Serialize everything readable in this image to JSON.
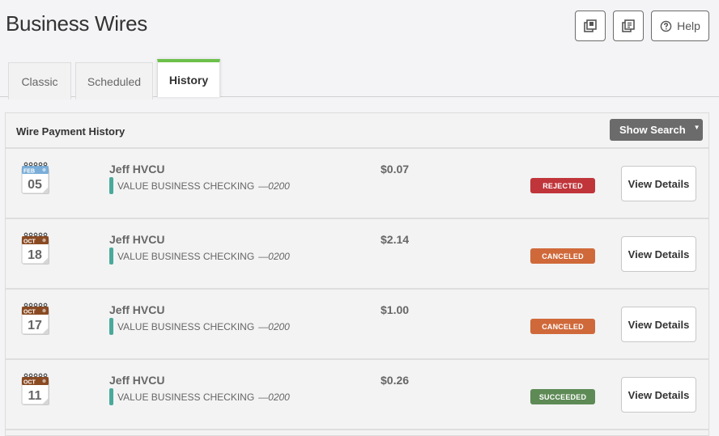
{
  "header": {
    "title": "Business Wires",
    "actions": [
      {
        "name": "print-list-icon",
        "label": ""
      },
      {
        "name": "report-list-icon",
        "label": ""
      },
      {
        "name": "help-icon",
        "label": "Help"
      }
    ]
  },
  "tabs": [
    {
      "label": "Classic",
      "active": false
    },
    {
      "label": "Scheduled",
      "active": false
    },
    {
      "label": "History",
      "active": true
    }
  ],
  "panel": {
    "title": "Wire Payment History",
    "show_search_label": "Show Search",
    "show_search_caret": "▼"
  },
  "status_colors": {
    "REJECTED": "#c0353a",
    "CANCELED": "#d0693a",
    "SUCCEEDED": "#5e8a56"
  },
  "month_colors": {
    "FEB": "#7aaed8",
    "OCT": "#8a4a22"
  },
  "account_accent": "#4aa99a",
  "wires": [
    {
      "month": "FEB",
      "day": "05",
      "payee": "Jeff HVCU",
      "account": "VALUE BUSINESS CHECKING",
      "account_mask": "—0200",
      "amount": "$0.07",
      "status": "REJECTED",
      "action": "View Details"
    },
    {
      "month": "OCT",
      "day": "18",
      "payee": "Jeff HVCU",
      "account": "VALUE BUSINESS CHECKING",
      "account_mask": "—0200",
      "amount": "$2.14",
      "status": "CANCELED",
      "action": "View Details"
    },
    {
      "month": "OCT",
      "day": "17",
      "payee": "Jeff HVCU",
      "account": "VALUE BUSINESS CHECKING",
      "account_mask": "—0200",
      "amount": "$1.00",
      "status": "CANCELED",
      "action": "View Details"
    },
    {
      "month": "OCT",
      "day": "11",
      "payee": "Jeff HVCU",
      "account": "VALUE BUSINESS CHECKING",
      "account_mask": "—0200",
      "amount": "$0.26",
      "status": "SUCCEEDED",
      "action": "View Details"
    }
  ]
}
